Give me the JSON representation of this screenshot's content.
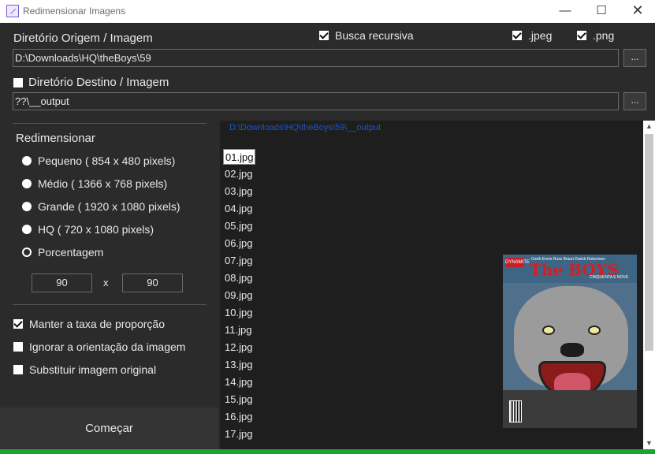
{
  "window": {
    "title": "Redimensionar Imagens",
    "min_glyph": "—",
    "max_glyph": "☐",
    "close_glyph": "✕"
  },
  "source": {
    "label": "Diretório Origem / Imagem",
    "path": "D:\\Downloads\\HQ\\theBoys\\59",
    "browse_label": "..."
  },
  "options_top": {
    "recursive": {
      "label": "Busca recursiva",
      "checked": true
    },
    "jpeg": {
      "label": ".jpeg",
      "checked": true
    },
    "png": {
      "label": ".png",
      "checked": true
    }
  },
  "destination": {
    "label": "Diretório Destino / Imagem",
    "checked": false,
    "path": "??\\__output",
    "browse_label": "..."
  },
  "resize": {
    "heading": "Redimensionar",
    "options": [
      {
        "label": "Pequeno ( 854 x 480 pixels)",
        "selected": false
      },
      {
        "label": "Médio ( 1366 x 768 pixels)",
        "selected": false
      },
      {
        "label": "Grande ( 1920 x 1080 pixels)",
        "selected": false
      },
      {
        "label": "HQ ( 720 x 1080 pixels)",
        "selected": false
      },
      {
        "label": "Porcentagem",
        "selected": true
      }
    ],
    "percent_w": "90",
    "percent_x": "x",
    "percent_h": "90"
  },
  "flags": {
    "keep_ratio": {
      "label": "Manter a taxa de proporção",
      "checked": true
    },
    "ignore_orientation": {
      "label": "Ignorar a orientação da imagem",
      "checked": false
    },
    "replace_original": {
      "label": "Substituir imagem original",
      "checked": false
    }
  },
  "start_label": "Começar",
  "output_path": "D:\\Downloads\\HQ\\theBoys\\59\\__output",
  "files": [
    "01.jpg",
    "02.jpg",
    "03.jpg",
    "04.jpg",
    "05.jpg",
    "06.jpg",
    "07.jpg",
    "08.jpg",
    "09.jpg",
    "10.jpg",
    "11.jpg",
    "12.jpg",
    "13.jpg",
    "14.jpg",
    "15.jpg",
    "16.jpg",
    "17.jpg"
  ],
  "selected_file": "01.jpg",
  "preview": {
    "brand": "DYNAMITE",
    "authors": "Garth Ennis  Russ Braun  Darick Robertson",
    "logo": "The BOYS",
    "subtitle": "CINQUENTA E NOVE"
  },
  "colors": {
    "background": "#2b2b2b",
    "panel": "#1e1e1e",
    "status": "#19a534",
    "path_link": "#1a56c8"
  }
}
